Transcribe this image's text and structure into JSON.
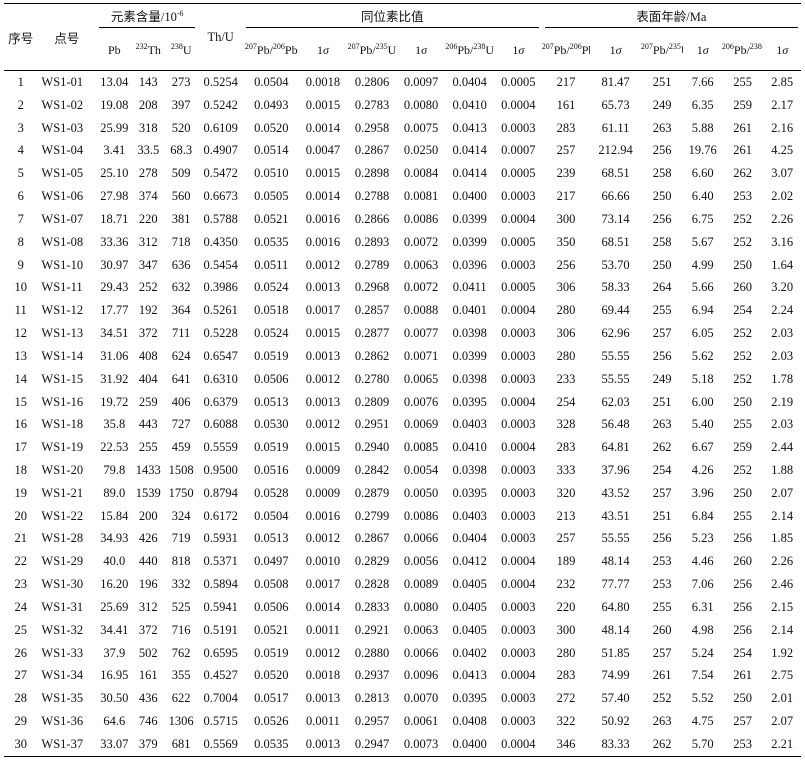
{
  "headers": {
    "no": "序号",
    "spot": "点号",
    "content_group": "元素含量/10",
    "content_group_sup": "-6",
    "th_u": "Th/U",
    "ratio_group": "同位素比值",
    "age_group": "表面年龄/Ma",
    "pb": "Pb",
    "th232_sup": "232",
    "th232": "Th",
    "u238_sup": "238",
    "u238": "U",
    "r76_sup_a": "207",
    "r76_a": "Pb/",
    "r76_sup_b": "206",
    "r76_b": "Pb",
    "one": "1",
    "sigma": "σ",
    "r75_sup_a": "207",
    "r75_a": "Pb/",
    "r75_sup_b": "235",
    "r75_b": "U",
    "r68_sup_a": "206",
    "r68_a": "Pb/",
    "r68_sup_b": "238",
    "r68_b": "U"
  },
  "rows": [
    [
      "1",
      "WS1-01",
      "13.04",
      "143",
      "273",
      "0.5254",
      "0.0504",
      "0.0018",
      "0.2806",
      "0.0097",
      "0.0404",
      "0.0005",
      "217",
      "81.47",
      "251",
      "7.66",
      "255",
      "2.85"
    ],
    [
      "2",
      "WS1-02",
      "19.08",
      "208",
      "397",
      "0.5242",
      "0.0493",
      "0.0015",
      "0.2783",
      "0.0080",
      "0.0410",
      "0.0004",
      "161",
      "65.73",
      "249",
      "6.35",
      "259",
      "2.17"
    ],
    [
      "3",
      "WS1-03",
      "25.99",
      "318",
      "520",
      "0.6109",
      "0.0520",
      "0.0014",
      "0.2958",
      "0.0075",
      "0.0413",
      "0.0003",
      "283",
      "61.11",
      "263",
      "5.88",
      "261",
      "2.16"
    ],
    [
      "4",
      "WS1-04",
      "3.41",
      "33.5",
      "68.3",
      "0.4907",
      "0.0514",
      "0.0047",
      "0.2867",
      "0.0250",
      "0.0414",
      "0.0007",
      "257",
      "212.94",
      "256",
      "19.76",
      "261",
      "4.25"
    ],
    [
      "5",
      "WS1-05",
      "25.10",
      "278",
      "509",
      "0.5472",
      "0.0510",
      "0.0015",
      "0.2898",
      "0.0084",
      "0.0414",
      "0.0005",
      "239",
      "68.51",
      "258",
      "6.60",
      "262",
      "3.07"
    ],
    [
      "6",
      "WS1-06",
      "27.98",
      "374",
      "560",
      "0.6673",
      "0.0505",
      "0.0014",
      "0.2788",
      "0.0081",
      "0.0400",
      "0.0003",
      "217",
      "66.66",
      "250",
      "6.40",
      "253",
      "2.02"
    ],
    [
      "7",
      "WS1-07",
      "18.71",
      "220",
      "381",
      "0.5788",
      "0.0521",
      "0.0016",
      "0.2866",
      "0.0086",
      "0.0399",
      "0.0004",
      "300",
      "73.14",
      "256",
      "6.75",
      "252",
      "2.26"
    ],
    [
      "8",
      "WS1-08",
      "33.36",
      "312",
      "718",
      "0.4350",
      "0.0535",
      "0.0016",
      "0.2893",
      "0.0072",
      "0.0399",
      "0.0005",
      "350",
      "68.51",
      "258",
      "5.67",
      "252",
      "3.16"
    ],
    [
      "9",
      "WS1-10",
      "30.97",
      "347",
      "636",
      "0.5454",
      "0.0511",
      "0.0012",
      "0.2789",
      "0.0063",
      "0.0396",
      "0.0003",
      "256",
      "53.70",
      "250",
      "4.99",
      "250",
      "1.64"
    ],
    [
      "10",
      "WS1-11",
      "29.43",
      "252",
      "632",
      "0.3986",
      "0.0524",
      "0.0013",
      "0.2968",
      "0.0072",
      "0.0411",
      "0.0005",
      "306",
      "58.33",
      "264",
      "5.66",
      "260",
      "3.20"
    ],
    [
      "11",
      "WS1-12",
      "17.77",
      "192",
      "364",
      "0.5261",
      "0.0518",
      "0.0017",
      "0.2857",
      "0.0088",
      "0.0401",
      "0.0004",
      "280",
      "69.44",
      "255",
      "6.94",
      "254",
      "2.24"
    ],
    [
      "12",
      "WS1-13",
      "34.51",
      "372",
      "711",
      "0.5228",
      "0.0524",
      "0.0015",
      "0.2877",
      "0.0077",
      "0.0398",
      "0.0003",
      "306",
      "62.96",
      "257",
      "6.05",
      "252",
      "2.03"
    ],
    [
      "13",
      "WS1-14",
      "31.06",
      "408",
      "624",
      "0.6547",
      "0.0519",
      "0.0013",
      "0.2862",
      "0.0071",
      "0.0399",
      "0.0003",
      "280",
      "55.55",
      "256",
      "5.62",
      "252",
      "2.03"
    ],
    [
      "14",
      "WS1-15",
      "31.92",
      "404",
      "641",
      "0.6310",
      "0.0506",
      "0.0012",
      "0.2780",
      "0.0065",
      "0.0398",
      "0.0003",
      "233",
      "55.55",
      "249",
      "5.18",
      "252",
      "1.78"
    ],
    [
      "15",
      "WS1-16",
      "19.72",
      "259",
      "406",
      "0.6379",
      "0.0513",
      "0.0013",
      "0.2809",
      "0.0076",
      "0.0395",
      "0.0004",
      "254",
      "62.03",
      "251",
      "6.00",
      "250",
      "2.19"
    ],
    [
      "16",
      "WS1-18",
      "35.8",
      "443",
      "727",
      "0.6088",
      "0.0530",
      "0.0012",
      "0.2951",
      "0.0069",
      "0.0403",
      "0.0003",
      "328",
      "56.48",
      "263",
      "5.40",
      "255",
      "2.03"
    ],
    [
      "17",
      "WS1-19",
      "22.53",
      "255",
      "459",
      "0.5559",
      "0.0519",
      "0.0015",
      "0.2940",
      "0.0085",
      "0.0410",
      "0.0004",
      "283",
      "64.81",
      "262",
      "6.67",
      "259",
      "2.44"
    ],
    [
      "18",
      "WS1-20",
      "79.8",
      "1433",
      "1508",
      "0.9500",
      "0.0516",
      "0.0009",
      "0.2842",
      "0.0054",
      "0.0398",
      "0.0003",
      "333",
      "37.96",
      "254",
      "4.26",
      "252",
      "1.88"
    ],
    [
      "19",
      "WS1-21",
      "89.0",
      "1539",
      "1750",
      "0.8794",
      "0.0528",
      "0.0009",
      "0.2879",
      "0.0050",
      "0.0395",
      "0.0003",
      "320",
      "43.52",
      "257",
      "3.96",
      "250",
      "2.07"
    ],
    [
      "20",
      "WS1-22",
      "15.84",
      "200",
      "324",
      "0.6172",
      "0.0504",
      "0.0016",
      "0.2799",
      "0.0086",
      "0.0403",
      "0.0003",
      "213",
      "43.51",
      "251",
      "6.84",
      "255",
      "2.14"
    ],
    [
      "21",
      "WS1-28",
      "34.93",
      "426",
      "719",
      "0.5931",
      "0.0513",
      "0.0012",
      "0.2867",
      "0.0066",
      "0.0404",
      "0.0003",
      "257",
      "55.55",
      "256",
      "5.23",
      "256",
      "1.85"
    ],
    [
      "22",
      "WS1-29",
      "40.0",
      "440",
      "818",
      "0.5371",
      "0.0497",
      "0.0010",
      "0.2829",
      "0.0056",
      "0.0412",
      "0.0004",
      "189",
      "48.14",
      "253",
      "4.46",
      "260",
      "2.26"
    ],
    [
      "23",
      "WS1-30",
      "16.20",
      "196",
      "332",
      "0.5894",
      "0.0508",
      "0.0017",
      "0.2828",
      "0.0089",
      "0.0405",
      "0.0004",
      "232",
      "77.77",
      "253",
      "7.06",
      "256",
      "2.46"
    ],
    [
      "24",
      "WS1-31",
      "25.69",
      "312",
      "525",
      "0.5941",
      "0.0506",
      "0.0014",
      "0.2833",
      "0.0080",
      "0.0405",
      "0.0003",
      "220",
      "64.80",
      "255",
      "6.31",
      "256",
      "2.15"
    ],
    [
      "25",
      "WS1-32",
      "34.41",
      "372",
      "716",
      "0.5191",
      "0.0521",
      "0.0011",
      "0.2921",
      "0.0063",
      "0.0405",
      "0.0003",
      "300",
      "48.14",
      "260",
      "4.98",
      "256",
      "2.14"
    ],
    [
      "26",
      "WS1-33",
      "37.9",
      "502",
      "762",
      "0.6595",
      "0.0519",
      "0.0012",
      "0.2880",
      "0.0066",
      "0.0402",
      "0.0003",
      "280",
      "51.85",
      "257",
      "5.24",
      "254",
      "1.92"
    ],
    [
      "27",
      "WS1-34",
      "16.95",
      "161",
      "355",
      "0.4527",
      "0.0520",
      "0.0018",
      "0.2937",
      "0.0096",
      "0.0413",
      "0.0004",
      "283",
      "74.99",
      "261",
      "7.54",
      "261",
      "2.75"
    ],
    [
      "28",
      "WS1-35",
      "30.50",
      "436",
      "622",
      "0.7004",
      "0.0517",
      "0.0013",
      "0.2813",
      "0.0070",
      "0.0395",
      "0.0003",
      "272",
      "57.40",
      "252",
      "5.52",
      "250",
      "2.01"
    ],
    [
      "29",
      "WS1-36",
      "64.6",
      "746",
      "1306",
      "0.5715",
      "0.0526",
      "0.0011",
      "0.2957",
      "0.0061",
      "0.0408",
      "0.0003",
      "322",
      "50.92",
      "263",
      "4.75",
      "257",
      "2.07"
    ],
    [
      "30",
      "WS1-37",
      "33.07",
      "379",
      "681",
      "0.5569",
      "0.0535",
      "0.0013",
      "0.2947",
      "0.0073",
      "0.0400",
      "0.0004",
      "346",
      "83.33",
      "262",
      "5.70",
      "253",
      "2.21"
    ]
  ]
}
